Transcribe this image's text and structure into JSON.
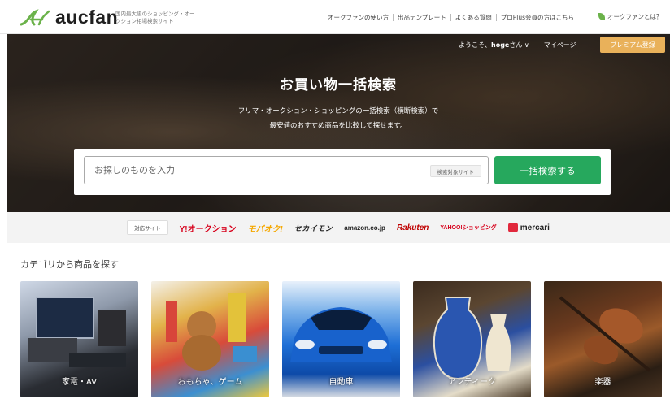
{
  "header": {
    "logo_text": "aucfan",
    "tagline": "国内最大級のショッピング・オークション相場検索サイト",
    "nav": [
      "オークファンの使い方",
      "出品テンプレート",
      "よくある質問",
      "プロPlus会員の方はこちら"
    ],
    "about_link": "オークファンとは？"
  },
  "hero": {
    "greeting": "ようこそ、",
    "username": "hoge",
    "greeting_suffix": "さん ∨",
    "mypage": "マイページ",
    "premium_button": "プレミアム登録",
    "title": "お買い物一括検索",
    "subtitle_line1": "フリマ・オークション・ショッピングの一括検索（横断検索）で",
    "subtitle_line2": "最安値のおすすめ商品を比較して探せます。",
    "search": {
      "placeholder": "お探しのものを入力",
      "value": "",
      "target_sites_button": "検索対象サイト",
      "submit_button": "一括検索する"
    }
  },
  "sites": {
    "label": "対応サイト",
    "logos": [
      "Y!オークション",
      "モバオク!",
      "セカイモン",
      "amazon.co.jp",
      "Rakuten",
      "YAHOO!ショッピング",
      "mercari"
    ]
  },
  "categories": {
    "heading": "カテゴリから商品を探す",
    "items": [
      "家電・AV",
      "おもちゃ、ゲーム",
      "自動車",
      "アンティーク",
      "楽器"
    ]
  },
  "colors": {
    "accent_green": "#26a85d",
    "premium_orange": "#e9b15a"
  }
}
